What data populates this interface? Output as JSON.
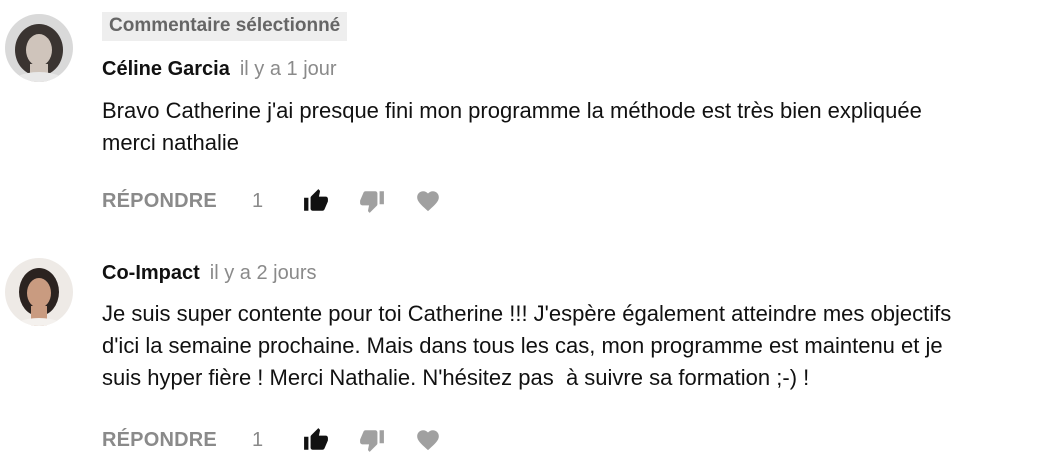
{
  "comments": [
    {
      "badge": "Commentaire sélectionné",
      "author": "Céline Garcia",
      "time": "il y a 1 jour",
      "text_lines": [
        "Bravo Catherine j'ai presque fini mon programme la méthode est très bien expliquée",
        "merci nathalie"
      ],
      "reply_label": "RÉPONDRE",
      "like_count": "1"
    },
    {
      "author": "Co-Impact",
      "time": "il y a 2 jours",
      "text_lines": [
        "Je suis super contente pour toi Catherine !!! J'espère également atteindre mes objectifs",
        "d'ici la semaine prochaine. Mais dans tous les cas, mon programme est maintenu et je",
        "suis hyper fière ! Merci Nathalie. N'hésitez pas  à suivre sa formation ;-) !"
      ],
      "reply_label": "RÉPONDRE",
      "like_count": "1"
    }
  ],
  "colors": {
    "text": "#111111",
    "muted": "#8a8a8a",
    "badge_bg": "#eeeeee",
    "like_active": "#111111",
    "icon_inactive": "#a0a0a0"
  },
  "icons": {
    "like": "thumbs-up-icon",
    "dislike": "thumbs-down-icon",
    "heart": "heart-icon"
  }
}
